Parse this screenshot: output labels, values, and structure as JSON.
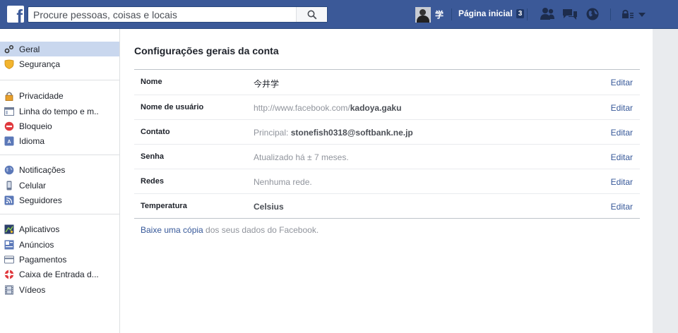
{
  "topbar": {
    "logo": "f",
    "search_placeholder": "Procure pessoas, coisas e locais",
    "profile_name": "学",
    "home_label": "Página inicial",
    "home_count": "3",
    "icons": [
      "friends-icon",
      "messages-icon",
      "notifications-globe-icon",
      "privacy-lock-icon",
      "chevron-down-icon"
    ]
  },
  "sidebar": {
    "groups": [
      [
        {
          "label": "Geral",
          "icon": "gear-icon",
          "selected": true
        },
        {
          "label": "Segurança",
          "icon": "shield-icon"
        }
      ],
      [
        {
          "label": "Privacidade",
          "icon": "lock-icon"
        },
        {
          "label": "Linha do tempo e m..",
          "icon": "timeline-icon"
        },
        {
          "label": "Bloqueio",
          "icon": "block-icon"
        },
        {
          "label": "Idioma",
          "icon": "language-icon"
        }
      ],
      [
        {
          "label": "Notificações",
          "icon": "globe-icon"
        },
        {
          "label": "Celular",
          "icon": "phone-icon"
        },
        {
          "label": "Seguidores",
          "icon": "rss-icon"
        }
      ],
      [
        {
          "label": "Aplicativos",
          "icon": "apps-icon"
        },
        {
          "label": "Anúncios",
          "icon": "ads-icon"
        },
        {
          "label": "Pagamentos",
          "icon": "card-icon"
        },
        {
          "label": "Caixa de Entrada d...",
          "icon": "lifebuoy-icon"
        },
        {
          "label": "Vídeos",
          "icon": "film-icon"
        }
      ]
    ]
  },
  "main": {
    "title": "Configurações gerais da conta",
    "rows": [
      {
        "label": "Nome",
        "value": "今井学",
        "edit": "Editar"
      },
      {
        "label": "Nome de usuário",
        "value_prefix": "http://www.facebook.com/",
        "value_bold": "kadoya.gaku",
        "edit": "Editar"
      },
      {
        "label": "Contato",
        "value_prefix": "Principal: ",
        "value_bold": "stonefish0318@softbank.ne.jp",
        "edit": "Editar"
      },
      {
        "label": "Senha",
        "value": "Atualizado há ± 7 meses.",
        "edit": "Editar"
      },
      {
        "label": "Redes",
        "value": "Nenhuma rede.",
        "edit": "Editar"
      },
      {
        "label": "Temperatura",
        "value": "Celsius",
        "edit": "Editar"
      }
    ],
    "download_link": "Baixe uma cópia",
    "download_suffix": " dos seus dados do Facebook."
  },
  "colors": {
    "brand_blue": "#3b5998",
    "link_blue": "#365899",
    "selected_bg": "#c9d7ee"
  }
}
